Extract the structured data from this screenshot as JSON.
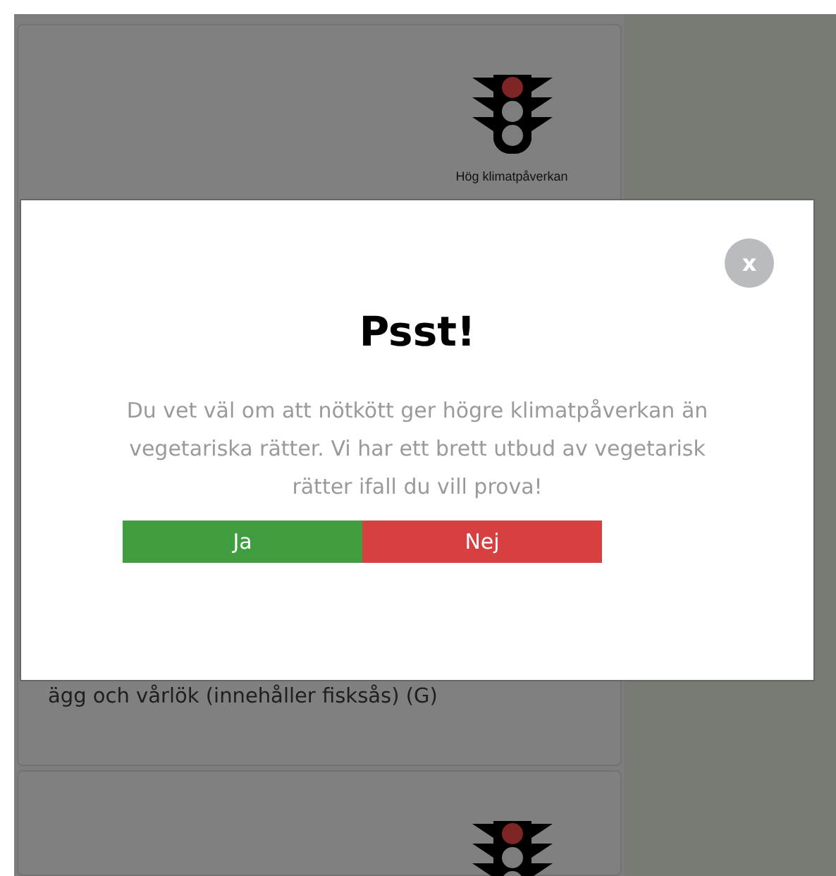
{
  "dishes": [
    {
      "color": "#7e2525",
      "impact_label": "Hög klimatpåverkan",
      "description": "ägg och vårlök (innehåller fisksås) (G)"
    },
    {
      "color": "#7e2525"
    }
  ],
  "modal": {
    "close": "x",
    "title": "Psst!",
    "message": "Du vet väl om att nötkött ger högre klimatpåverkan än vegetariska rätter. Vi har ett brett utbud av vegetarisk rätter ifall du vill prova!",
    "buttons": [
      {
        "label": "Ja",
        "kind": "yes"
      },
      {
        "label": "Nej",
        "kind": "no"
      }
    ]
  }
}
